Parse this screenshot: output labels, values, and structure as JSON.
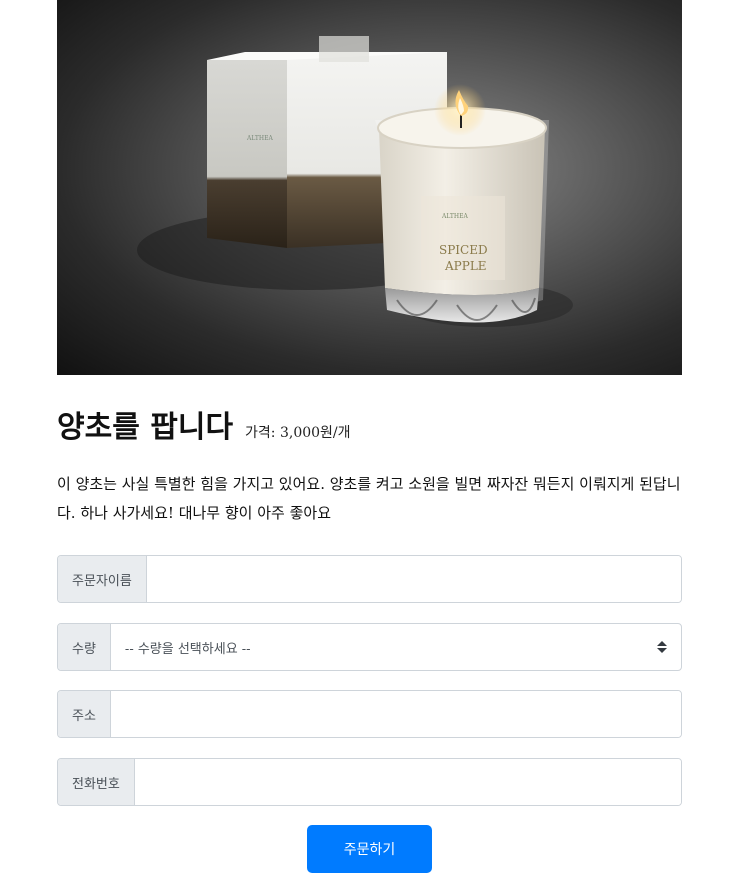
{
  "product": {
    "image_alt": "ALTHEA SPICED APPLE",
    "box_brand": "ALTHEA",
    "glass_brand": "ALTHEA",
    "glass_line1": "SPICED",
    "glass_line2": "APPLE",
    "title": "양초를 팝니다",
    "price": "가격: 3,000원/개",
    "description": "이 양초는 사실 특별한 힘을 가지고 있어요. 양초를 켜고 소원을 빌면 짜자잔 뭐든지 이뤄지게 된답니다. 하나 사가세요! 대나무 향이 아주 좋아요"
  },
  "form": {
    "name_label": "주문자이름",
    "name_value": "",
    "quantity_label": "수량",
    "quantity_selected": "-- 수량을 선택하세요 --",
    "address_label": "주소",
    "address_value": "",
    "phone_label": "전화번호",
    "phone_value": "",
    "submit_label": "주문하기"
  },
  "colors": {
    "primary": "#007bff",
    "addon_bg": "#e9ecef",
    "border": "#ced4da"
  }
}
